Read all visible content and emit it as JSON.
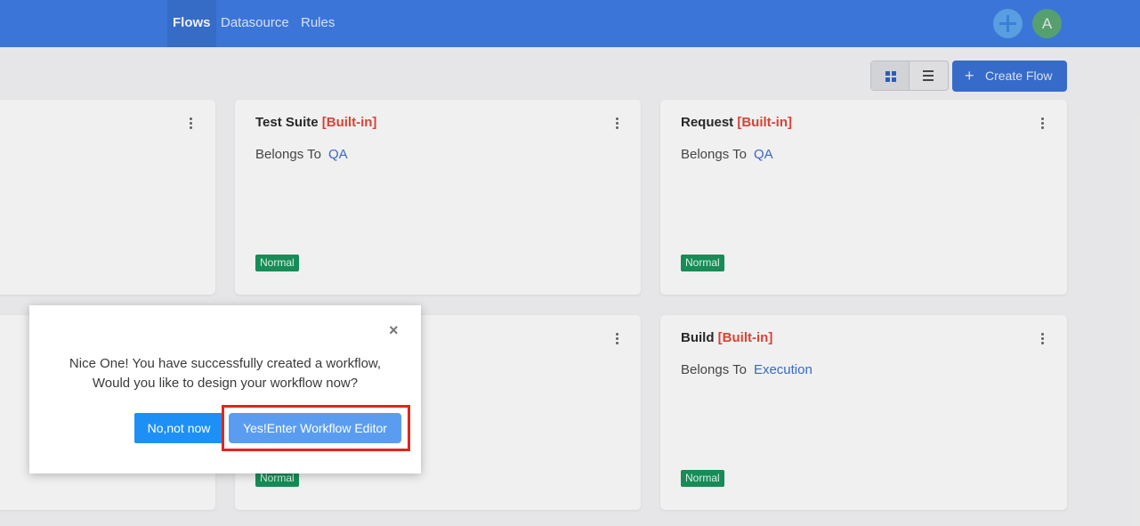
{
  "nav": {
    "items": [
      {
        "label": "Flows",
        "active": true
      },
      {
        "label": "Datasource",
        "active": false
      },
      {
        "label": "Rules",
        "active": false
      }
    ],
    "avatar_letter": "A",
    "add_icon": "plus-circle-icon"
  },
  "toolbar": {
    "grid_view_icon": "grid-icon",
    "list_view_icon": "list-icon",
    "create_plus": "+",
    "create_label": "Create Flow"
  },
  "cards": [
    {
      "title": "",
      "tag": "",
      "belongs_label": "",
      "group": "",
      "status": ""
    },
    {
      "title": "Test Suite",
      "tag": "[Built-in]",
      "belongs_label": "Belongs To",
      "group": "QA",
      "status": "Normal"
    },
    {
      "title": "Request",
      "tag": "[Built-in]",
      "belongs_label": "Belongs To",
      "group": "QA",
      "status": "Normal"
    },
    {
      "title": "",
      "tag": "",
      "belongs_label": "",
      "group": "",
      "status": ""
    },
    {
      "title": "",
      "tag": "",
      "belongs_label": "",
      "group": "",
      "status": "Normal"
    },
    {
      "title": "Build",
      "tag": "[Built-in]",
      "belongs_label": "Belongs To",
      "group": "Execution",
      "status": "Normal"
    }
  ],
  "dialog": {
    "close": "×",
    "line1": "Nice One! You have successfully created a workflow,",
    "line2": "Would you like to design your workflow now?",
    "no_label": "No,not now",
    "yes_label": "Yes!Enter Workflow Editor"
  },
  "colors": {
    "header": "#3f7de6",
    "builtin": "#e14a3c",
    "badge": "#19955c",
    "highlight": "#e0261c"
  }
}
